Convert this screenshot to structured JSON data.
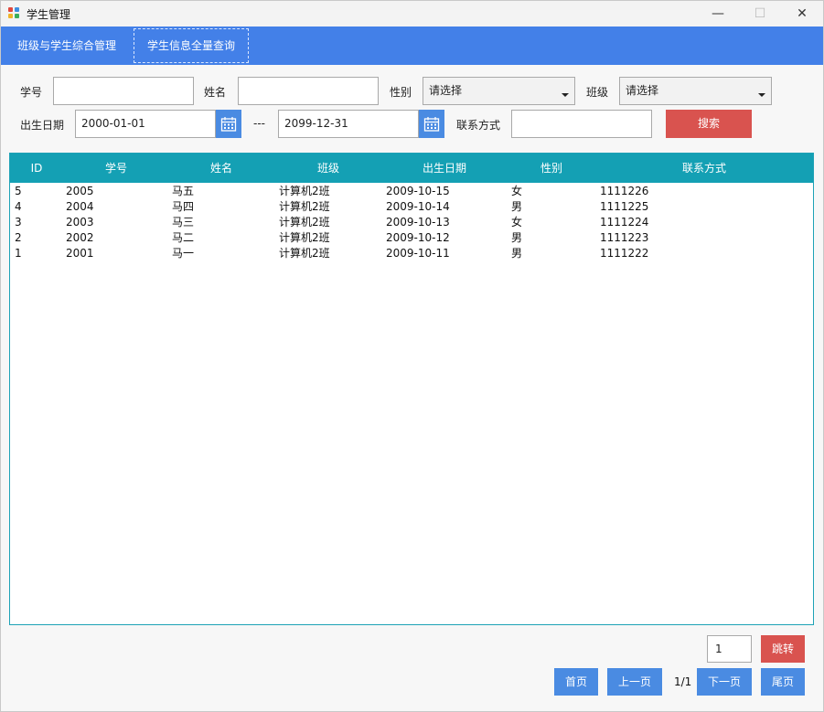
{
  "window": {
    "title": "学生管理",
    "controls": [
      "minimize-icon",
      "maximize-icon",
      "close-icon"
    ]
  },
  "tabs": [
    {
      "label": "班级与学生综合管理",
      "active": false
    },
    {
      "label": "学生信息全量查询",
      "active": true
    }
  ],
  "filters": {
    "student_no_label": "学号",
    "student_no_value": "",
    "name_label": "姓名",
    "name_value": "",
    "gender_label": "性别",
    "gender_selected": "请选择",
    "class_label": "班级",
    "class_selected": "请选择",
    "birth_label": "出生日期",
    "birth_from": "2000-01-01",
    "range_sep": "---",
    "birth_to": "2099-12-31",
    "contact_label": "联系方式",
    "contact_value": "",
    "search_label": "搜索"
  },
  "table": {
    "columns": [
      "ID",
      "学号",
      "姓名",
      "班级",
      "出生日期",
      "性别",
      "联系方式"
    ],
    "rows": [
      {
        "id": "5",
        "no": "2005",
        "name": "马五",
        "cls": "计算机2班",
        "birth": "2009-10-15",
        "gender": "女",
        "contact": "1111226"
      },
      {
        "id": "4",
        "no": "2004",
        "name": "马四",
        "cls": "计算机2班",
        "birth": "2009-10-14",
        "gender": "男",
        "contact": "1111225"
      },
      {
        "id": "3",
        "no": "2003",
        "name": "马三",
        "cls": "计算机2班",
        "birth": "2009-10-13",
        "gender": "女",
        "contact": "1111224"
      },
      {
        "id": "2",
        "no": "2002",
        "name": "马二",
        "cls": "计算机2班",
        "birth": "2009-10-12",
        "gender": "男",
        "contact": "1111223"
      },
      {
        "id": "1",
        "no": "2001",
        "name": "马一",
        "cls": "计算机2班",
        "birth": "2009-10-11",
        "gender": "男",
        "contact": "1111222"
      }
    ]
  },
  "pager": {
    "page_input": "1",
    "jump_label": "跳转",
    "first_label": "首页",
    "prev_label": "上一页",
    "page_info": "1/1",
    "next_label": "下一页",
    "last_label": "尾页"
  },
  "colors": {
    "tabbar": "#4380e8",
    "table_header": "#14a0b4",
    "danger": "#d9534f",
    "primary": "#4a8be2"
  }
}
